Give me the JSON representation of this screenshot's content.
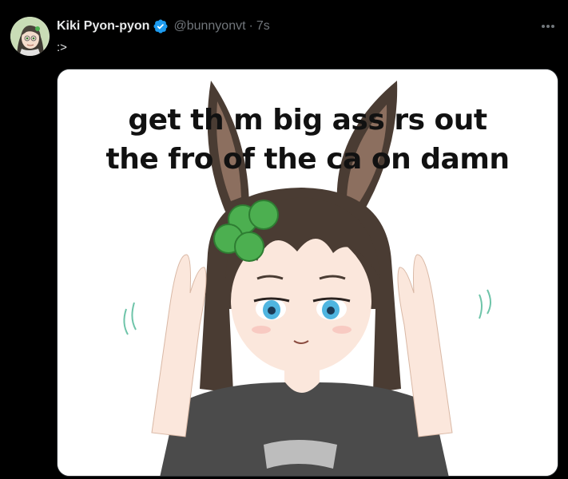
{
  "tweet": {
    "display_name": "Kiki Pyon-pyon",
    "handle": "@bunnyonvt",
    "separator": "·",
    "timestamp": "7s",
    "text": ":>",
    "verified": true
  },
  "media": {
    "caption_line1": "get th  m big ass  rs out",
    "caption_line2": "the fro   of the ca    on damn"
  },
  "colors": {
    "background": "#000000",
    "text_primary": "#e7e9ea",
    "text_secondary": "#71767b",
    "verified_badge": "#1d9bf0",
    "border": "#2f3336"
  },
  "icons": [
    "verified-badge-icon",
    "more-options-icon"
  ]
}
